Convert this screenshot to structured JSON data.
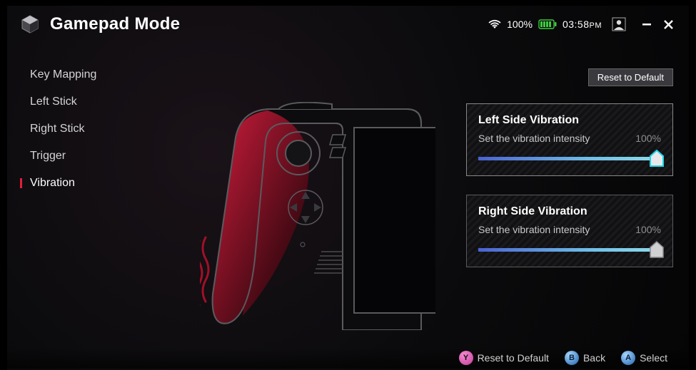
{
  "header": {
    "title": "Gamepad Mode",
    "wifi_signal": "full",
    "battery_pct": "100%",
    "time": "03:58",
    "ampm": "PM"
  },
  "sidebar": {
    "items": [
      {
        "label": "Key Mapping",
        "active": false
      },
      {
        "label": "Left Stick",
        "active": false
      },
      {
        "label": "Right Stick",
        "active": false
      },
      {
        "label": "Trigger",
        "active": false
      },
      {
        "label": "Vibration",
        "active": true
      }
    ]
  },
  "controls": {
    "reset_label": "Reset to Default"
  },
  "vibration": {
    "left": {
      "title": "Left Side Vibration",
      "desc": "Set the vibration intensity",
      "value_pct": "100%",
      "value": 100,
      "focused": true
    },
    "right": {
      "title": "Right Side Vibration",
      "desc": "Set the vibration intensity",
      "value_pct": "100%",
      "value": 100,
      "focused": false
    }
  },
  "footer": {
    "hints": [
      {
        "button": "Y",
        "label": "Reset to Default"
      },
      {
        "button": "B",
        "label": "Back"
      },
      {
        "button": "A",
        "label": "Select"
      }
    ]
  }
}
